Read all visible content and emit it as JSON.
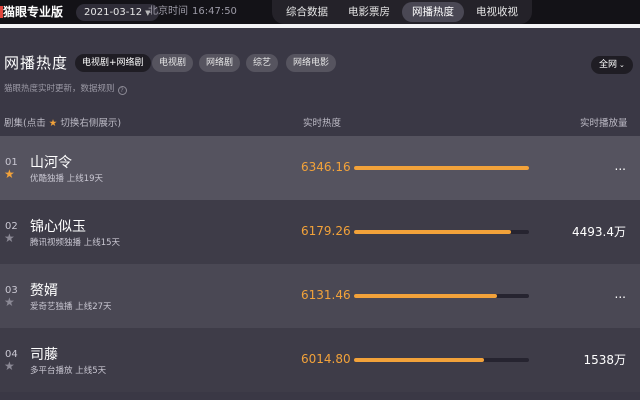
{
  "topbar": {
    "logo": "猫眼专业版",
    "date": "2021-03-12",
    "clock_label": "北京时间",
    "clock_time": "16:47:50",
    "nav": [
      {
        "label": "综合数据",
        "active": false
      },
      {
        "label": "电影票房",
        "active": false
      },
      {
        "label": "网播热度",
        "active": true
      },
      {
        "label": "电视收视",
        "active": false
      }
    ]
  },
  "section": {
    "title": "网播热度",
    "filters": [
      {
        "label": "电视剧+网络剧",
        "active": true
      },
      {
        "label": "电视剧",
        "active": false
      },
      {
        "label": "网络剧",
        "active": false
      },
      {
        "label": "综艺",
        "active": false
      },
      {
        "label": "网络电影",
        "active": false
      }
    ],
    "scope": "全网",
    "note": "猫眼热度实时更新，数据规则"
  },
  "columns": {
    "name_prefix": "剧集(点击",
    "name_suffix": "切换右侧展示)",
    "heat": "实时热度",
    "play": "实时播放量"
  },
  "rows": [
    {
      "rank": "01",
      "name": "山河令",
      "platform": "优酷独播",
      "days": "上线19天",
      "heat": "6346.16",
      "heat_value": 6346.16,
      "play": "...",
      "starred": true
    },
    {
      "rank": "02",
      "name": "锦心似玉",
      "platform": "腾讯视频独播",
      "days": "上线15天",
      "heat": "6179.26",
      "heat_value": 6179.26,
      "play": "4493.4万",
      "starred": false
    },
    {
      "rank": "03",
      "name": "赘婿",
      "platform": "爱奇艺独播",
      "days": "上线27天",
      "heat": "6131.46",
      "heat_value": 6131.46,
      "play": "...",
      "starred": false
    },
    {
      "rank": "04",
      "name": "司藤",
      "platform": "多平台播放",
      "days": "上线5天",
      "heat": "6014.80",
      "heat_value": 6014.8,
      "play": "1538万",
      "starred": false
    }
  ],
  "heat_bar_fraction": [
    1.0,
    0.895,
    0.817,
    0.742
  ],
  "colors": {
    "accent": "#f2a23a",
    "background": "#3a3845"
  }
}
